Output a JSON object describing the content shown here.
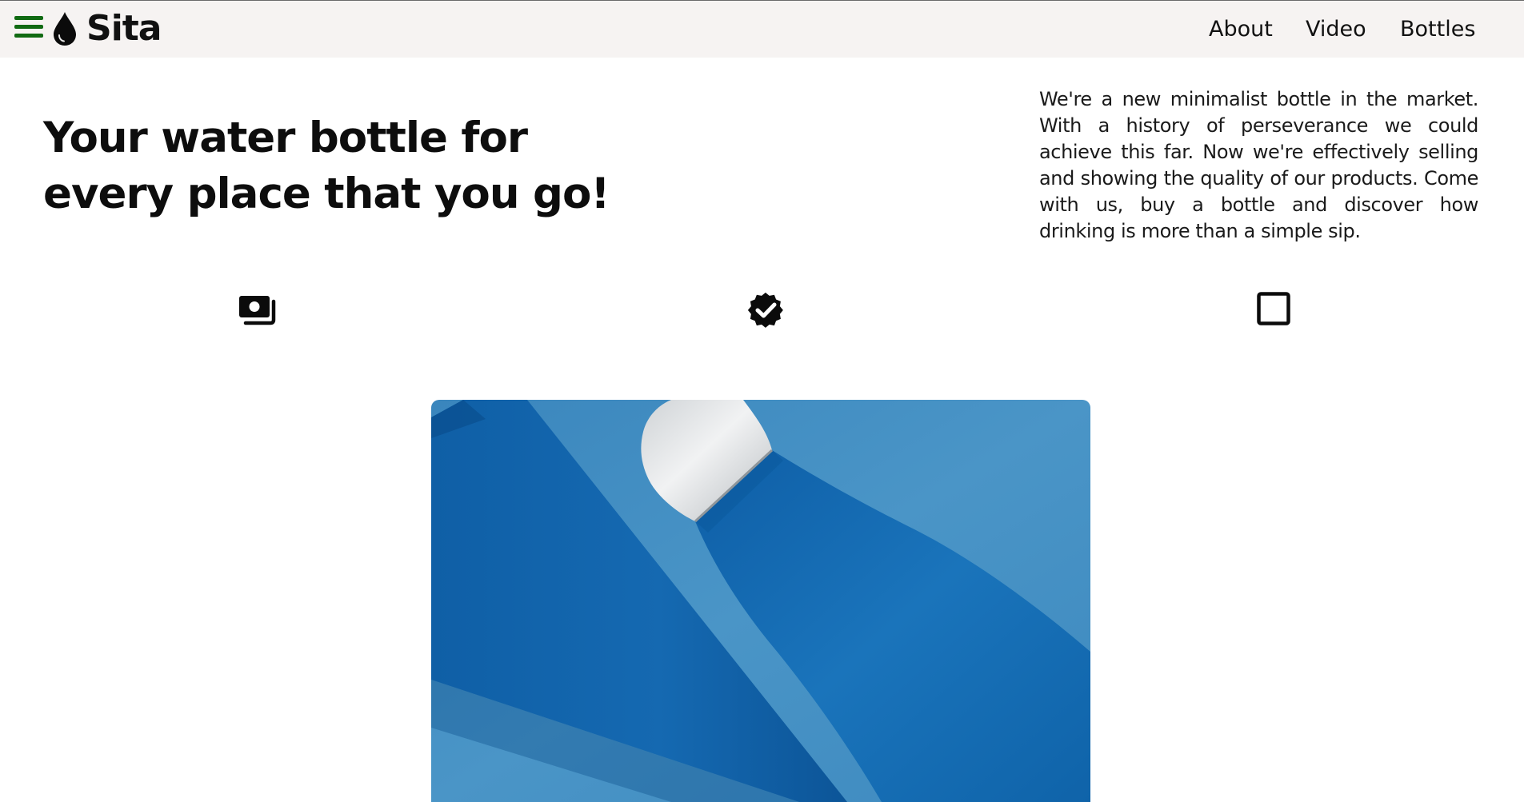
{
  "brand": {
    "name": "Sita",
    "logo_icon": "water-drop-icon",
    "menu_icon": "hamburger-menu-icon",
    "menu_color": "#116a13"
  },
  "nav": {
    "about": "About",
    "video": "Video",
    "bottles": "Bottles"
  },
  "hero": {
    "title": "Your water bottle for every place that you go!",
    "description": "We're a new minimalist bottle in the market. With a history of perseverance we could achieve this far. Now we're effectively selling and showing the quality of our products. Come with us, buy a bottle and discover how drinking is more than a simple sip."
  },
  "features": [
    {
      "icon": "money-bills-icon"
    },
    {
      "icon": "verified-badge-icon"
    },
    {
      "icon": "square-outline-icon"
    }
  ],
  "product_image": {
    "subject": "blue-water-bottles-photo",
    "background_color": "#3d8bbf",
    "bottle_color": "#1369b3",
    "cap_color": "#e6e8ea"
  }
}
